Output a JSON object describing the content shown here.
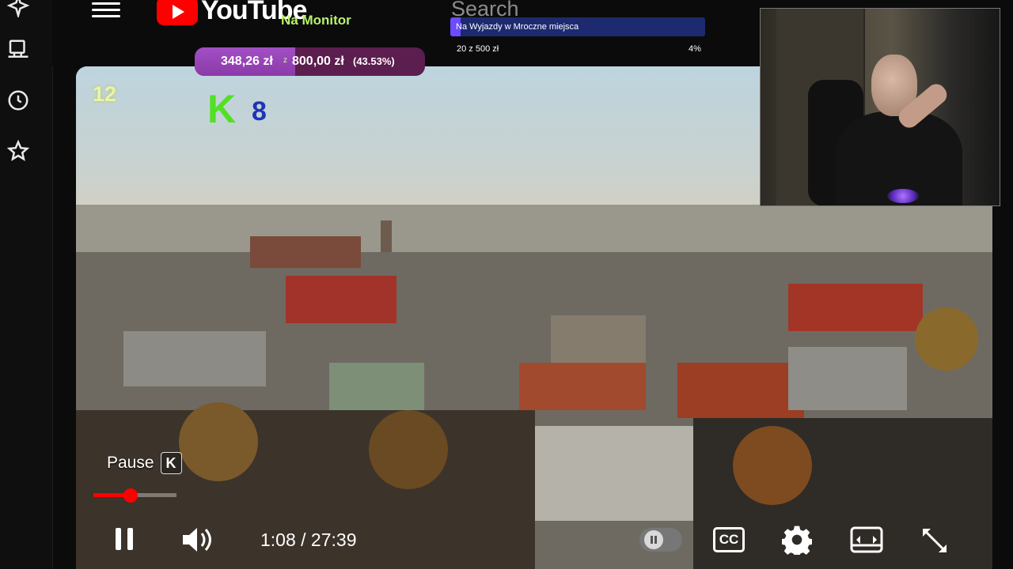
{
  "overlay": {
    "brand_text": "YouTube",
    "brand_subtitle": "Na Monitor",
    "search_label": "Search",
    "goal": {
      "title": "Na Wyjazdy w Mroczne miejsca",
      "amount": "20 z 500 zł",
      "percent_text": "4%",
      "percent": 4
    },
    "donation": {
      "current": "348,26 zł",
      "z": "z",
      "target": "800,00 zł",
      "percent_text": "(43.53%)",
      "percent": 43.53
    },
    "rating_badge": "12",
    "channel_logo_letter": "K",
    "channel_number": "8"
  },
  "sidebar": {
    "icons": [
      "sparkle-icon",
      "computer-icon",
      "history-icon",
      "star-icon"
    ]
  },
  "player": {
    "tooltip_text": "Pause",
    "tooltip_key": "K",
    "progress_fraction": 0.45,
    "time": "1:08 / 27:39",
    "cc_label": "CC",
    "colors": {
      "progress": "#ff0000",
      "brand": "#ff0000",
      "goal_bar": "#1d2a6f",
      "donation_bar": "#a24fc4"
    }
  }
}
